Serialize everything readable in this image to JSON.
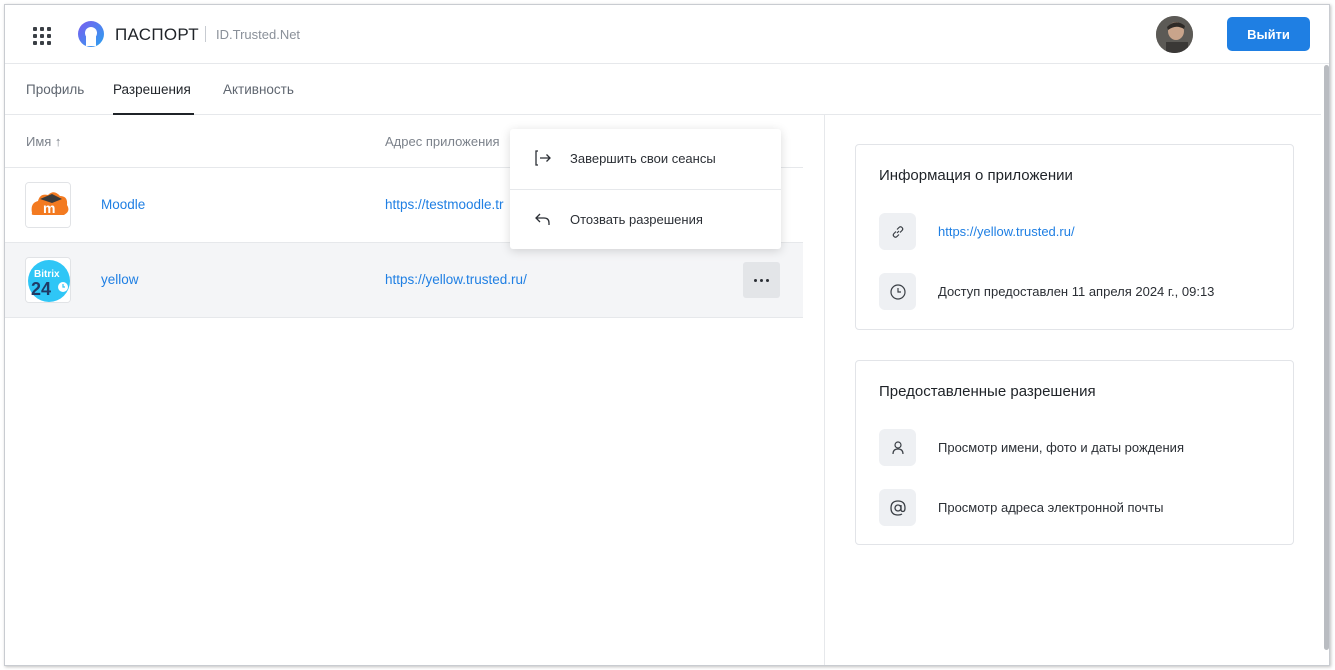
{
  "header": {
    "brand": "ПАСПОРТ",
    "brand_sub": "ID.Trusted.Net",
    "logout_label": "Выйти",
    "accent_color": "#1f7fe3"
  },
  "tabs": [
    {
      "label": "Профиль",
      "active": false
    },
    {
      "label": "Разрешения",
      "active": true
    },
    {
      "label": "Активность",
      "active": false
    }
  ],
  "table": {
    "col_name": "Имя ↑",
    "col_url": "Адрес приложения",
    "rows": [
      {
        "name": "Moodle",
        "url": "https://testmoodle.tr",
        "icon": "moodle-logo"
      },
      {
        "name": "yellow",
        "url": "https://yellow.trusted.ru/",
        "icon": "bitrix24-logo",
        "icon_text_top": "Bitrix",
        "icon_text_bottom": "24",
        "selected": true
      }
    ]
  },
  "menu": {
    "items": [
      {
        "label": "Завершить свои сеансы",
        "icon": "sign-out-icon"
      },
      {
        "label": "Отозвать разрешения",
        "icon": "undo-arrow-icon"
      }
    ]
  },
  "app_info": {
    "title": "Информация о приложении",
    "url": "https://yellow.trusted.ru/",
    "access_granted": "Доступ предоставлен 11 апреля 2024 г., 09:13"
  },
  "permissions": {
    "title": "Предоставленные разрешения",
    "items": [
      {
        "label": "Просмотр имени, фото и даты рождения",
        "icon": "user-icon"
      },
      {
        "label": "Просмотр адреса электронной почты",
        "icon": "at-sign-icon"
      }
    ]
  }
}
